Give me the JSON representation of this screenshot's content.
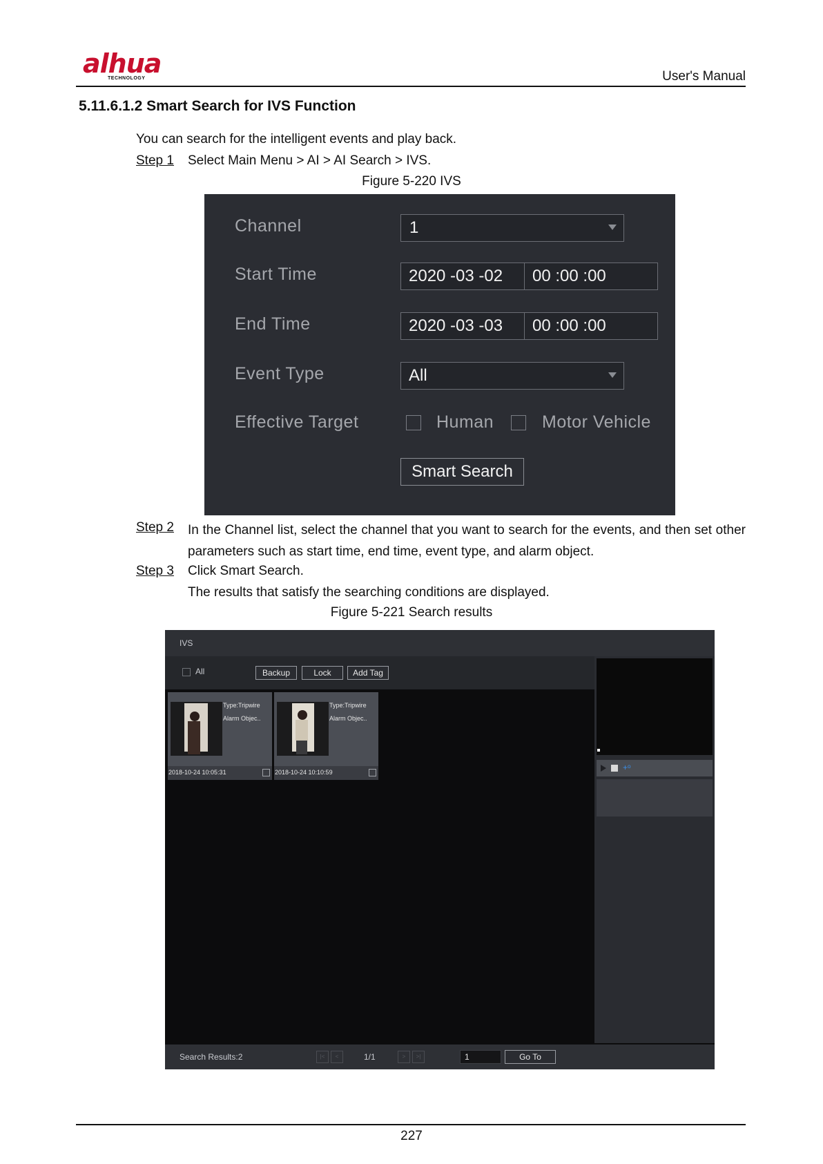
{
  "header": {
    "logo_text": "alhua",
    "logo_subtext": "TECHNOLOGY",
    "manual_title": "User's Manual"
  },
  "section": {
    "heading": "5.11.6.1.2 Smart Search for IVS Function",
    "intro": "You can search for the intelligent events and play back."
  },
  "steps": [
    {
      "label": "Step 1",
      "text": "Select Main Menu > AI > AI Search > IVS."
    },
    {
      "label": "Step 2",
      "text": "In the Channel list, select the channel that you want to search for the events, and then set other parameters such as start time, end time, event type, and alarm object."
    },
    {
      "label": "Step 3",
      "text": "Click Smart Search.",
      "result": "The results that satisfy the searching conditions are displayed."
    }
  ],
  "figure1": {
    "caption": "Figure 5-220 IVS",
    "channel_label": "Channel",
    "channel_value": "1",
    "start_label": "Start Time",
    "start_date": "2020 -03 -02",
    "start_time": "00 :00 :00",
    "end_label": "End Time",
    "end_date": "2020 -03 -03",
    "end_time": "00 :00 :00",
    "event_label": "Event Type",
    "event_value": "All",
    "target_label": "Effective Target",
    "target_human": "Human",
    "target_vehicle": "Motor Vehicle",
    "search_button": "Smart Search"
  },
  "figure2": {
    "caption": "Figure 5-221 Search results",
    "title": "IVS",
    "all_label": "All",
    "backup_button": "Backup",
    "lock_button": "Lock",
    "add_tag_button": "Add Tag",
    "results": [
      {
        "type": "Type:Tripwire",
        "object": "Alarm Objec..",
        "timestamp": "2018-10-24 10:05:31"
      },
      {
        "type": "Type:Tripwire",
        "object": "Alarm Objec..",
        "timestamp": "2018-10-24 10:10:59"
      }
    ],
    "footer": {
      "results_count": "Search Results:2",
      "page": "1/1",
      "goto_value": "1",
      "goto_button": "Go To"
    }
  },
  "page_number": "227"
}
